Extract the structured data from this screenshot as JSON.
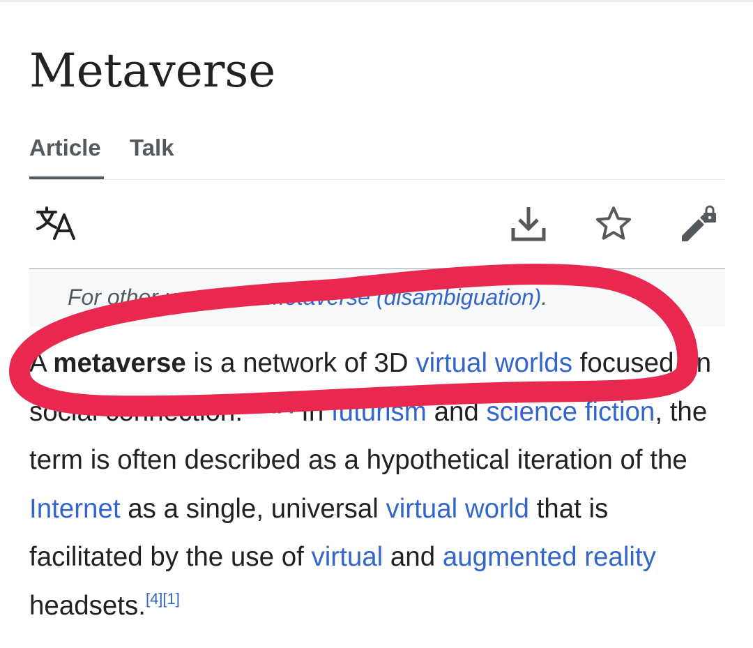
{
  "article": {
    "title": "Metaverse",
    "tabs": [
      {
        "label": "Article",
        "active": true
      },
      {
        "label": "Talk",
        "active": false
      }
    ]
  },
  "actions": {
    "icons": [
      "language-icon",
      "download-icon",
      "star-icon",
      "edit-lock-icon"
    ]
  },
  "hatnote": {
    "prefix": "For other uses, see ",
    "link": "Metaverse (disambiguation)",
    "suffix": "."
  },
  "lead": {
    "p1_start": "A ",
    "bold_term": "metaverse",
    "p1_mid": " is a network of 3D ",
    "link_virtual_worlds": "virtual worlds",
    "p1_focus": " focused on social connection.",
    "refs_a": [
      "[1]",
      "[2]",
      "[3]"
    ],
    "in": " In ",
    "link_futurism": "futurism",
    "and1": " and ",
    "link_science_fiction": "science fiction",
    "p2": ", the term is often described as a hypothetical iteration of the ",
    "link_internet": "Internet",
    "p3": " as a single, universal ",
    "link_virtual_world": "virtual world",
    "p4": " that is facilitated by the use of ",
    "link_virtual": "virtual",
    "and2": " and ",
    "link_augmented_reality": "augmented reality",
    "p5": " headsets.",
    "refs_b": [
      "[4]",
      "[1]"
    ]
  },
  "colors": {
    "link": "#3366cc",
    "text": "#202122",
    "annotation": "#e8284f"
  },
  "annotation": {
    "type": "hand-drawn-circle"
  }
}
